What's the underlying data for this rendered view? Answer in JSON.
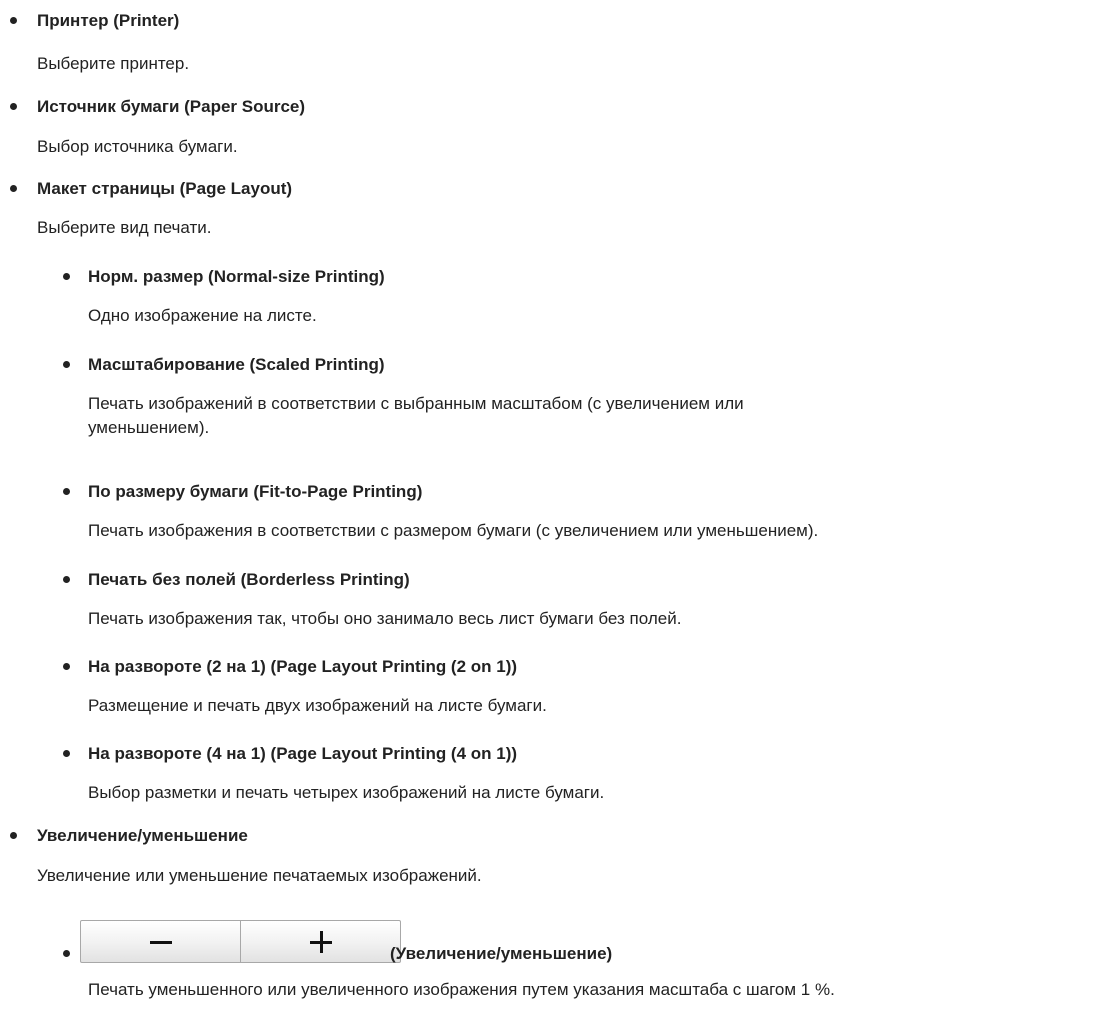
{
  "sections": [
    {
      "heading": "Принтер (Printer)",
      "text": "Выберите принтер."
    },
    {
      "heading": "Источник бумаги (Paper Source)",
      "text": "Выбор источника бумаги."
    },
    {
      "heading": "Макет страницы (Page Layout)",
      "text": "Выберите вид печати."
    },
    {
      "heading": "Увеличение/уменьшение",
      "text": "Увеличение или уменьшение печатаемых изображений."
    }
  ],
  "layout_options": [
    {
      "heading": "Норм. размер (Normal-size Printing)",
      "text": "Одно изображение на листе."
    },
    {
      "heading": "Масштабирование (Scaled Printing)",
      "text": "Печать изображений в соответствии с выбранным масштабом (с увеличением или уменьшением)."
    },
    {
      "heading": "По размеру бумаги (Fit-to-Page Printing)",
      "text": "Печать изображения в соответствии с размером бумаги (с увеличением или уменьшением)."
    },
    {
      "heading": "Печать без полей (Borderless Printing)",
      "text": "Печать изображения так, чтобы оно занимало весь лист бумаги без полей."
    },
    {
      "heading": "На развороте (2 на 1) (Page Layout Printing (2 on 1))",
      "text": "Размещение и печать двух изображений на листе бумаги."
    },
    {
      "heading": "На развороте (4 на 1) (Page Layout Printing (4 on 1))",
      "text": "Выбор разметки и печать четырех изображений на листе бумаги."
    }
  ],
  "zoom_control": {
    "label": "(Увеличение/уменьшение)",
    "text": "Печать уменьшенного или увеличенного изображения путем указания масштаба с шагом 1 %.",
    "minus_icon": "minus-icon",
    "plus_icon": "plus-icon"
  }
}
